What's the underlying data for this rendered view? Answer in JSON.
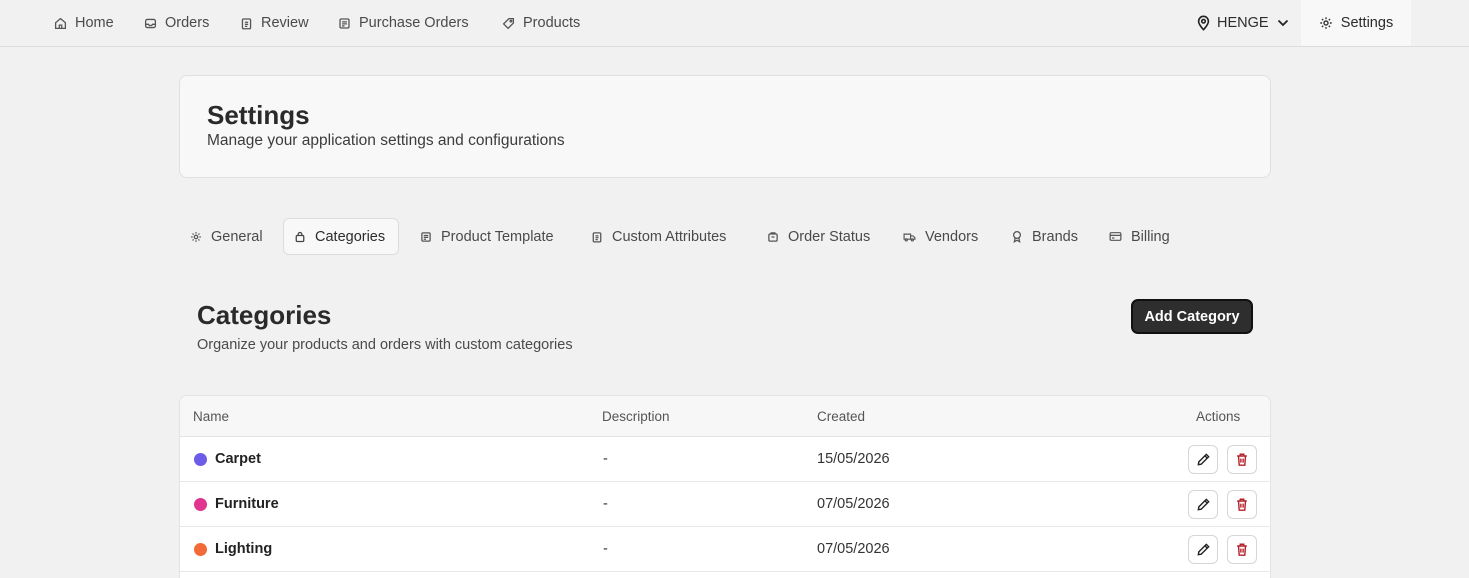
{
  "nav": {
    "items": [
      {
        "label": "Home",
        "icon": "home-icon"
      },
      {
        "label": "Orders",
        "icon": "inbox-icon"
      },
      {
        "label": "Review",
        "icon": "clipboard-icon"
      },
      {
        "label": "Purchase Orders",
        "icon": "receipt-icon"
      },
      {
        "label": "Products",
        "icon": "tag-icon"
      }
    ],
    "location": "HENGE",
    "settings_label": "Settings"
  },
  "header": {
    "title": "Settings",
    "subtitle": "Manage your application settings and configurations"
  },
  "tabs": [
    {
      "label": "General",
      "icon": "gear-icon"
    },
    {
      "label": "Categories",
      "icon": "bag-icon",
      "active": true
    },
    {
      "label": "Product Template",
      "icon": "template-icon"
    },
    {
      "label": "Custom Attributes",
      "icon": "clipboard-icon"
    },
    {
      "label": "Order Status",
      "icon": "package-icon"
    },
    {
      "label": "Vendors",
      "icon": "truck-icon"
    },
    {
      "label": "Brands",
      "icon": "badge-icon"
    },
    {
      "label": "Billing",
      "icon": "card-icon"
    }
  ],
  "section": {
    "title": "Categories",
    "subtitle": "Organize your products and orders with custom categories",
    "add_label": "Add Category"
  },
  "table": {
    "columns": [
      "Name",
      "Description",
      "Created",
      "Actions"
    ],
    "rows": [
      {
        "name": "Carpet",
        "color": "#6c5ce7",
        "description": "-",
        "created": "15/05/2026"
      },
      {
        "name": "Furniture",
        "color": "#e0358f",
        "description": "-",
        "created": "07/05/2026"
      },
      {
        "name": "Lighting",
        "color": "#f26a38",
        "description": "-",
        "created": "07/05/2026"
      }
    ]
  },
  "colors": {
    "accent_dark": "#2e2e2e",
    "delete_red": "#b3202a"
  }
}
